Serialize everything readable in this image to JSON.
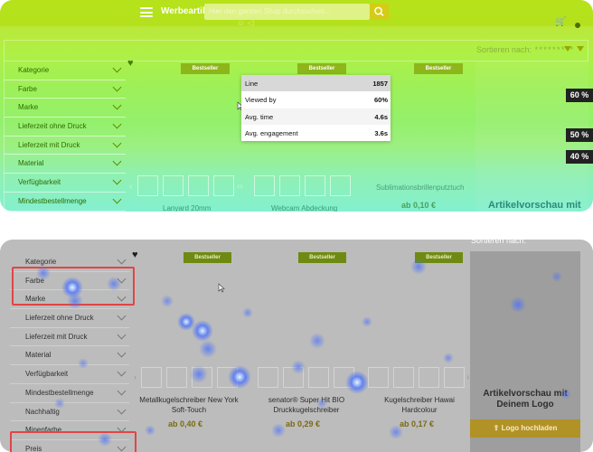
{
  "header": {
    "brand": "Werbeartike",
    "search_placeholder": "Hier den ganzen Shop durchsuchen..."
  },
  "sort": {
    "label": "Sortieren nach:",
    "value": "*********"
  },
  "filters": [
    "Kategorie",
    "Farbe",
    "Marke",
    "Lieferzeit ohne Druck",
    "Lieferzeit mit Druck",
    "Material",
    "Verfügbarkeit",
    "Mindestbestellmenge",
    "Nachhaltig",
    "Minenfarbe",
    "Preis"
  ],
  "badge_label": "Bestseller",
  "tooltip": {
    "rows": [
      {
        "key": "Line",
        "value": "1857"
      },
      {
        "key": "Viewed by",
        "value": "60%"
      },
      {
        "key": "Avg. time",
        "value": "4.6s"
      },
      {
        "key": "Avg. engagement",
        "value": "3.6s"
      }
    ]
  },
  "scroll_badges": [
    "60 %",
    "50 %",
    "40 %"
  ],
  "top_products": {
    "names": [
      "Lanyard 20mm",
      "Webcam Abdeckung",
      "Sublimationsbrillenputztuch"
    ],
    "price": "ab  0,10 €"
  },
  "preview_title_top": "Artikelvorschau mit",
  "products": [
    {
      "name_line1": "Metallkugelschreiber New York",
      "name_line2": "Soft-Touch",
      "price": "ab  0,40 €"
    },
    {
      "name_line1": "senator® Super Hit BIO",
      "name_line2": "Druckkugelschreiber",
      "price": "ab  0,29 €"
    },
    {
      "name_line1": "Kugelschreiber Hawai",
      "name_line2": "Hardcolour",
      "price": "ab  0,17 €"
    }
  ],
  "preview": {
    "title_line1": "Artikelvorschau mit",
    "title_line2": "Deinem Logo",
    "upload_label": "Logo hochladen"
  },
  "colors": {
    "scroll_map_top": "#b5e21a",
    "scroll_map_bottom": "#83f0cf",
    "badge_bg": "#222222",
    "highlight": "#e24545",
    "heat_blob": "#3c5dff"
  }
}
